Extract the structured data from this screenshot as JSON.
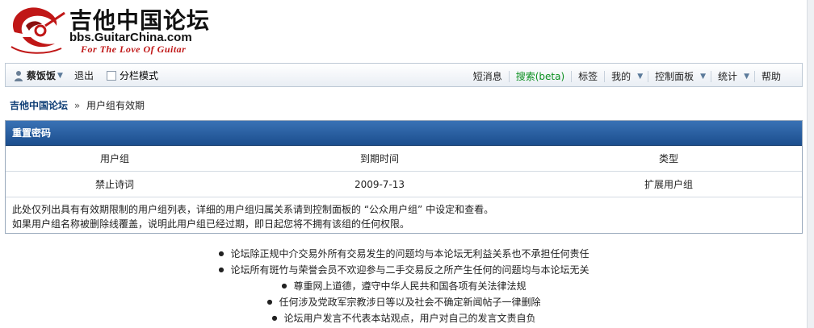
{
  "logo": {
    "title": "吉他中国论坛",
    "domain": "bbs.GuitarChina.com",
    "slogan": "For The Love Of Guitar"
  },
  "nav": {
    "username": "蔡饭饭",
    "logout": "退出",
    "split_mode": "分栏模式",
    "right_items": {
      "messages": "短消息",
      "search": "搜索(beta)",
      "tags": "标签",
      "mine": "我的",
      "control_panel": "控制面板",
      "stats": "统计",
      "help": "帮助"
    }
  },
  "breadcrumb": {
    "home": "吉他中国论坛",
    "separator": "»",
    "current": "用户组有效期"
  },
  "box": {
    "title": "重置密码",
    "headers": [
      "用户组",
      "到期时间",
      "类型"
    ],
    "rows": [
      [
        "禁止诗词",
        "2009-7-13",
        "扩展用户组"
      ]
    ],
    "notes": [
      "此处仅列出具有有效期限制的用户组列表，详细的用户组归属关系请到控制面板的 “公众用户组” 中设定和查看。",
      "如果用户组名称被删除线覆盖，说明此用户组已经过期，即日起您将不拥有该组的任何权限。"
    ]
  },
  "footer": {
    "items": [
      "论坛除正规中介交易外所有交易发生的问题均与本论坛无利益关系也不承担任何责任",
      "论坛所有斑竹与荣誉会员不欢迎参与二手交易反之所产生任何的问题均与本论坛无关",
      "尊重网上道德，遵守中华人民共和国各项有关法律法规",
      "任何涉及党政军宗教涉日等以及社会不确定新闻帖子一律删除",
      "论坛用户发言不代表本站观点，用户对自己的发言文责自负"
    ]
  },
  "colors": {
    "header_blue": "#1c4e8e",
    "link_blue": "#0c3c74",
    "search_green": "#0a8f1e",
    "slogan_red": "#c01717"
  }
}
